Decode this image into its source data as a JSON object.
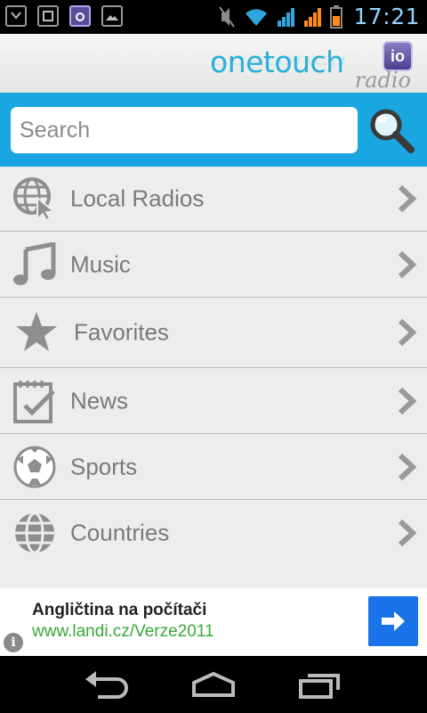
{
  "status_bar": {
    "time": "17:21"
  },
  "header": {
    "logo_text": "onetouch",
    "logo_badge": "io",
    "logo_sub": "radio"
  },
  "search": {
    "placeholder": "Search"
  },
  "menu": {
    "items": [
      {
        "label": "Local Radios",
        "icon": "globe-cursor-icon"
      },
      {
        "label": "Music",
        "icon": "music-note-icon"
      },
      {
        "label": "Favorites",
        "icon": "star-icon"
      },
      {
        "label": "News",
        "icon": "checklist-icon"
      },
      {
        "label": "Sports",
        "icon": "soccer-ball-icon"
      },
      {
        "label": "Countries",
        "icon": "globe-icon"
      }
    ]
  },
  "ad": {
    "title": "Angličtina na počítači",
    "url": "www.landi.cz/Verze2011",
    "info": "i"
  },
  "colors": {
    "accent": "#1aa6e0",
    "icon_gray": "#8e8e8e",
    "ad_url": "#38a838",
    "ad_button": "#1a73e8"
  }
}
